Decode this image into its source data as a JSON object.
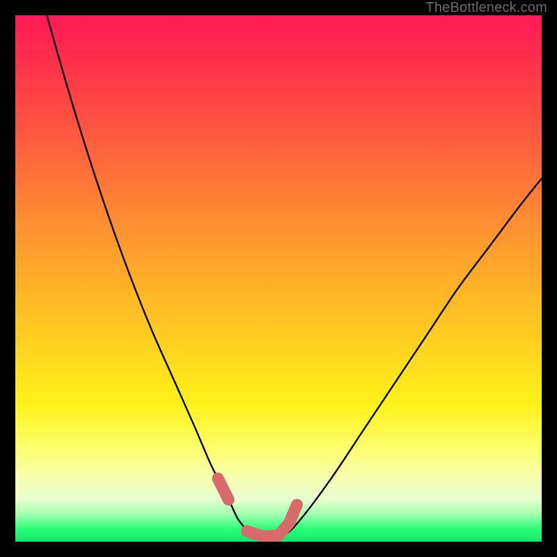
{
  "watermark": "TheBottleneck.com",
  "colors": {
    "curve": "#000000",
    "marker": "#d96a6a",
    "frame": "#000000"
  },
  "chart_data": {
    "type": "line",
    "title": "",
    "xlabel": "",
    "ylabel": "",
    "xlim": [
      0,
      100
    ],
    "ylim": [
      0,
      100
    ],
    "grid": false,
    "legend": false,
    "series": [
      {
        "name": "bottleneck-curve",
        "color": "#000000",
        "x": [
          6,
          10,
          14,
          18,
          22,
          26,
          30,
          34,
          37,
          39.5,
          41,
          42.5,
          45,
          48,
          51,
          54,
          60,
          66,
          72,
          78,
          84,
          90,
          96,
          100
        ],
        "y": [
          100,
          86,
          73,
          61,
          50,
          40,
          31,
          22,
          15,
          10,
          7,
          4,
          1.5,
          0.8,
          1.2,
          4,
          12,
          21,
          30,
          39,
          48,
          56,
          64,
          69
        ]
      },
      {
        "name": "sweet-spot-markers",
        "color": "#d96a6a",
        "x": [
          38.5,
          40.5,
          44,
          47,
          50,
          52,
          53.5
        ],
        "y": [
          12,
          8,
          2,
          1,
          1.2,
          3.5,
          7
        ]
      }
    ],
    "annotations": [
      {
        "text": "TheBottleneck.com",
        "position": "top-right"
      }
    ]
  }
}
